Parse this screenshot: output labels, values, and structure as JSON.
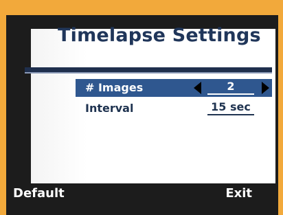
{
  "screen": {
    "title": "Timelapse Settings"
  },
  "settings": [
    {
      "label": "# Images",
      "value": "2",
      "selected": true
    },
    {
      "label": "Interval",
      "value": "15 sec",
      "selected": false
    }
  ],
  "softkeys": {
    "left_label": "Default",
    "right_label": "Exit"
  },
  "colors": {
    "background": "#f2a93b",
    "title": "#20365a",
    "highlight": "#2f578f",
    "bezel": "#1c1c1c"
  },
  "icons": {
    "decrement": "left-triangle-icon",
    "increment": "right-triangle-icon"
  }
}
